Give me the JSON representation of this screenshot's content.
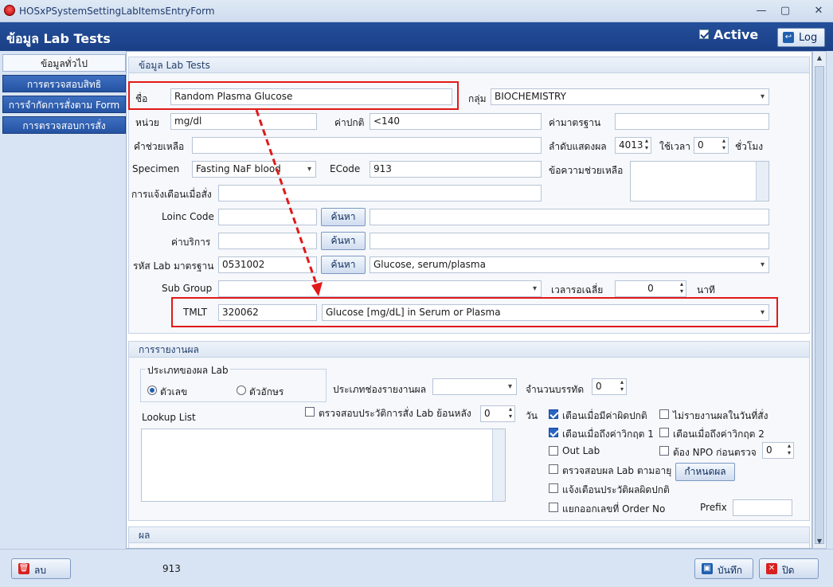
{
  "window": {
    "title": "HOSxPSystemSettingLabItemsEntryForm"
  },
  "header": {
    "title": "ข้อมูล Lab Tests",
    "active_label": "Active",
    "active_checked": true,
    "log_label": "Log"
  },
  "sidebar": {
    "tabs": [
      {
        "label": "ข้อมูลทั่วไป",
        "selected": true
      },
      {
        "label": "การตรวจสอบสิทธิ"
      },
      {
        "label": "การจำกัดการสั่งตาม Form"
      },
      {
        "label": "การตรวจสอบการสั่ง"
      }
    ]
  },
  "general": {
    "title": "ข้อมูล Lab Tests",
    "name_label": "ชื่อ",
    "name_value": "Random Plasma Glucose",
    "group_label": "กลุ่ม",
    "group_value": "BIOCHEMISTRY",
    "unit_label": "หน่วย",
    "unit_value": "mg/dl",
    "normal_label": "ค่าปกติ",
    "normal_value": "<140",
    "standard_label": "ค่ามาตรฐาน",
    "standard_value": "",
    "help_value_label": "คำช่วยเหลือ",
    "help_value": "",
    "display_order_label": "ลำดับแสดงผล",
    "display_order_value": "4013",
    "time_used_label": "ใช้เวลา",
    "time_used_value": "0",
    "hours_label": "ชั่วโมง",
    "specimen_label": "Specimen",
    "specimen_value": "Fasting NaF blood",
    "ecode_label": "ECode",
    "ecode_value": "913",
    "help_msg_label": "ข้อความช่วยเหลือ",
    "order_alert_label": "การแจ้งเตือนเมื่อสั่ง",
    "order_alert_value": "",
    "loinc_label": "Loinc Code",
    "loinc_value": "",
    "loinc_desc": "",
    "service_fee_label": "ค่าบริการ",
    "service_fee_value": "",
    "service_fee_desc": "",
    "std_lab_code_label": "รหัส Lab มาตรฐาน",
    "std_lab_code_value": "0531002",
    "std_lab_code_desc": "Glucose, serum/plasma",
    "search_label": "ค้นหา",
    "subgroup_label": "Sub Group",
    "subgroup_value": "",
    "avg_wait_label": "เวลารอเฉลี่ย",
    "avg_wait_value": "0",
    "minutes_label": "นาที",
    "tmlt_label": "TMLT",
    "tmlt_code": "320062",
    "tmlt_desc": "Glucose [mg/dL] in Serum or Plasma"
  },
  "report": {
    "title": "การรายงานผล",
    "result_type_title": "ประเภทของผล Lab",
    "numeric_label": "ตัวเลข",
    "text_label": "ตัวอักษร",
    "field_type_label": "ประเภทช่องรายงานผล",
    "field_type_value": "",
    "line_count_label": "จำนวนบรรทัด",
    "line_count_value": "0",
    "lookup_label": "Lookup List",
    "check_history_label": "ตรวจสอบประวัติการสั่ง Lab ย้อนหลัง",
    "check_history_value": "0",
    "days_label": "วัน",
    "warn_abnormal_label": "เตือนเมื่อมีค่าผิดปกติ",
    "no_report_today_label": "ไม่รายงานผลในวันที่สั่ง",
    "warn_critical1_label": "เตือนเมื่อถึงค่าวิกฤต 1",
    "warn_critical2_label": "เตือนเมื่อถึงค่าวิกฤต 2",
    "out_lab_label": "Out Lab",
    "npo_label": "ต้อง NPO ก่อนตรวจ",
    "npo_value": "0",
    "check_by_age_label": "ตรวจสอบผล Lab ตามอายุ",
    "set_result_label": "กำหนดผล",
    "alert_history_label": "แจ้งเตือนประวัติผลผิดปกติ",
    "separate_order_label": "แยกออกเลขที่ Order No",
    "prefix_label": "Prefix",
    "prefix_value": ""
  },
  "result": {
    "title": "ผล"
  },
  "footer": {
    "delete_label": "ลบ",
    "code_value": "913",
    "save_label": "บันทึก",
    "close_label": "ปิด"
  },
  "colors": {
    "header": "#1a3f86",
    "highlight": "#e11919",
    "tab": "#2553a3"
  }
}
